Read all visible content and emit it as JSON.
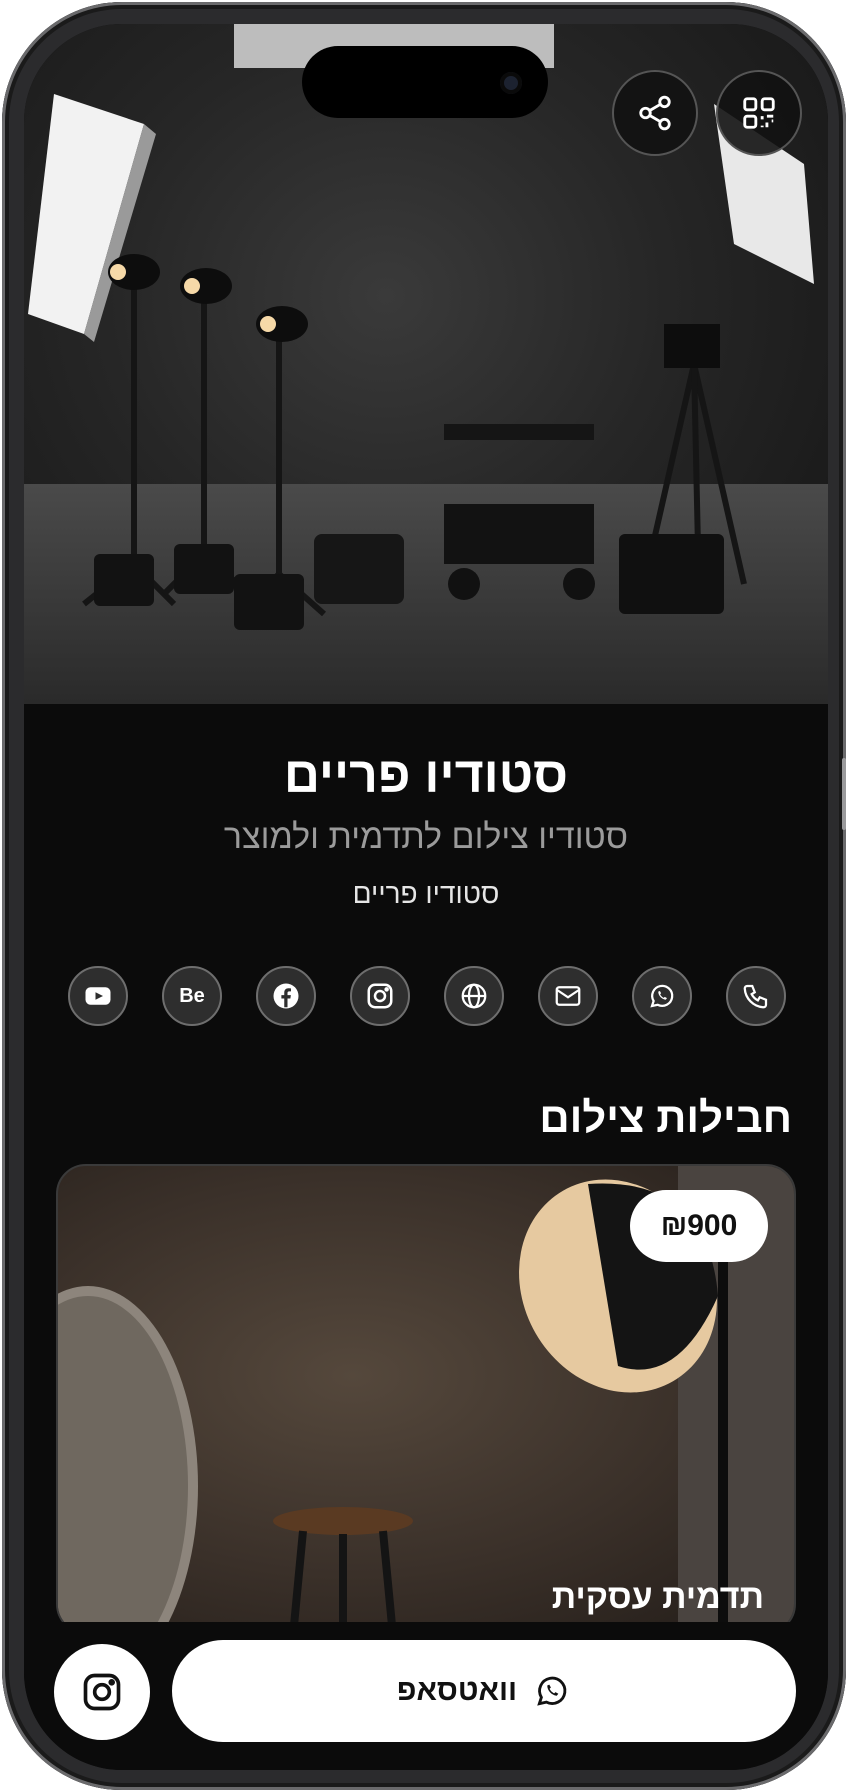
{
  "hero": {
    "share_icon": "share-icon",
    "qr_icon": "qr-code-icon"
  },
  "profile": {
    "title": "סטודיו פריים",
    "subtitle": "סטודיו צילום לתדמית ולמוצר",
    "tag": "סטודיו פריים"
  },
  "socials": [
    {
      "name": "youtube-icon"
    },
    {
      "name": "behance-icon",
      "text": "Be"
    },
    {
      "name": "facebook-icon"
    },
    {
      "name": "instagram-icon"
    },
    {
      "name": "globe-icon"
    },
    {
      "name": "mail-icon"
    },
    {
      "name": "whatsapp-icon"
    },
    {
      "name": "phone-icon"
    }
  ],
  "packages": {
    "section_title": "חבילות צילום",
    "items": [
      {
        "price": "₪900",
        "title": "תדמית עסקית"
      }
    ]
  },
  "bottom_bar": {
    "whatsapp_label": "וואטסאפ",
    "instagram_icon": "instagram-icon",
    "whatsapp_icon": "whatsapp-icon"
  },
  "colors": {
    "background": "#0b0b0b",
    "button_bg": "#ffffff",
    "icon_circle": "#2e2e2e"
  }
}
